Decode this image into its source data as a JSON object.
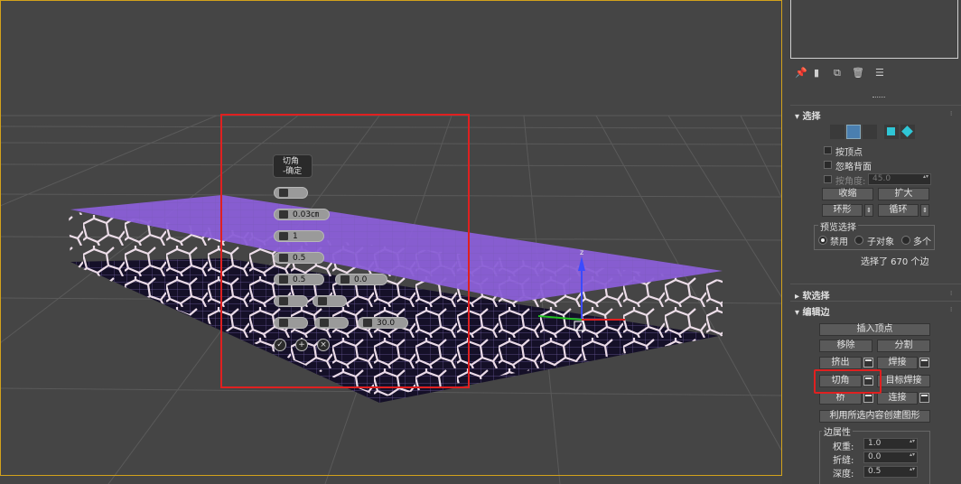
{
  "caddy": {
    "title_line1": "切角",
    "title_line2": "-确定",
    "fields": [
      {
        "name": "caddy-edge-chamfer-amount",
        "value": "0.03㎝"
      },
      {
        "name": "caddy-segments",
        "value": "1"
      },
      {
        "name": "caddy-tension",
        "value": "0.5"
      },
      {
        "name": "caddy-value-a",
        "value": "0.5"
      },
      {
        "name": "caddy-value-b",
        "value": "0.0"
      },
      {
        "name": "caddy-angle",
        "value": "30.0"
      }
    ]
  },
  "panel": {
    "selection": {
      "header": "选择",
      "by_vertex": "按顶点",
      "ignore_backfacing": "忽略背面",
      "by_angle": "按角度:",
      "angle_value": "45.0",
      "shrink": "收缩",
      "grow": "扩大",
      "ring": "环形",
      "loop": "循环",
      "preview_group": "预览选择",
      "preview_options": [
        "禁用",
        "子对象",
        "多个"
      ],
      "status": "选择了 670 个边"
    },
    "soft_selection": {
      "header": "软选择"
    },
    "edit_edges": {
      "header": "编辑边",
      "insert_vertex": "插入顶点",
      "remove": "移除",
      "split": "分割",
      "extrude": "挤出",
      "weld": "焊接",
      "chamfer": "切角",
      "target_weld": "目标焊接",
      "bridge": "桥",
      "connect": "连接",
      "create_shape": "利用所选内容创建图形",
      "edge_props_group": "边属性",
      "weight_label": "权重:",
      "weight_value": "1.0",
      "crease_label": "折缝:",
      "crease_value": "0.0",
      "depth_label": "深度:",
      "depth_value": "0.5"
    }
  },
  "colors": {
    "top_plate": "#8a5fd6",
    "lattice": "#f4e4f0",
    "viewport_border": "#d2a21c",
    "highlight": "#e02020",
    "active_mode": "#4a7fb0"
  }
}
